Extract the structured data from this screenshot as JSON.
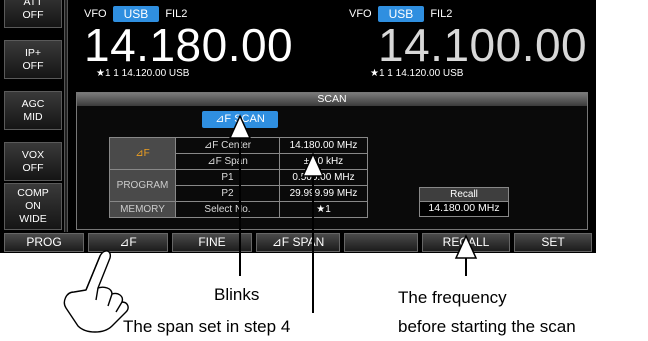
{
  "sidebar": {
    "items": [
      {
        "line1": "ATT",
        "line2": "OFF"
      },
      {
        "line1": "IP+",
        "line2": "OFF"
      },
      {
        "line1": "AGC",
        "line2": "MID"
      },
      {
        "line1": "VOX",
        "line2": "OFF"
      },
      {
        "line1": "COMP",
        "line2": "ON",
        "line3": "WIDE"
      }
    ]
  },
  "main_vfo": {
    "vfo": "VFO",
    "mode": "USB",
    "filter": "FIL2",
    "frequency": "14.180.00",
    "sub": "★1   1  14.120.00  USB"
  },
  "sub_vfo": {
    "vfo": "VFO",
    "mode": "USB",
    "filter": "FIL2",
    "frequency": "14.100.00",
    "sub": "★1   1  14.120.00  USB"
  },
  "scan": {
    "title": "SCAN",
    "df_scan_label": "⊿F SCAN",
    "table": {
      "df_label": "⊿F",
      "df_center_label": "⊿F Center",
      "df_center_value": "14.180.00 MHz",
      "df_span_label": "⊿F Span",
      "df_span_value": "±   10  kHz",
      "program_label": "PROGRAM",
      "p1_label": "P1",
      "p1_value": "0.500.00 MHz",
      "p2_label": "P2",
      "p2_value": "29.999.99 MHz",
      "memory_label": "MEMORY",
      "memory_select": "Select No.",
      "memory_value": "★1"
    },
    "recall_label": "Recall",
    "recall_value": "14.180.00  MHz"
  },
  "bottom_bar": {
    "prog": "PROG",
    "df": "⊿F",
    "fine": "FINE",
    "df_span": "⊿F SPAN",
    "recall": "RECALL",
    "set": "SET"
  },
  "annotations": {
    "blinks": "Blinks",
    "span_set": "The span set in step 4",
    "freq_line1": "The frequency",
    "freq_line2": "before starting the scan"
  }
}
